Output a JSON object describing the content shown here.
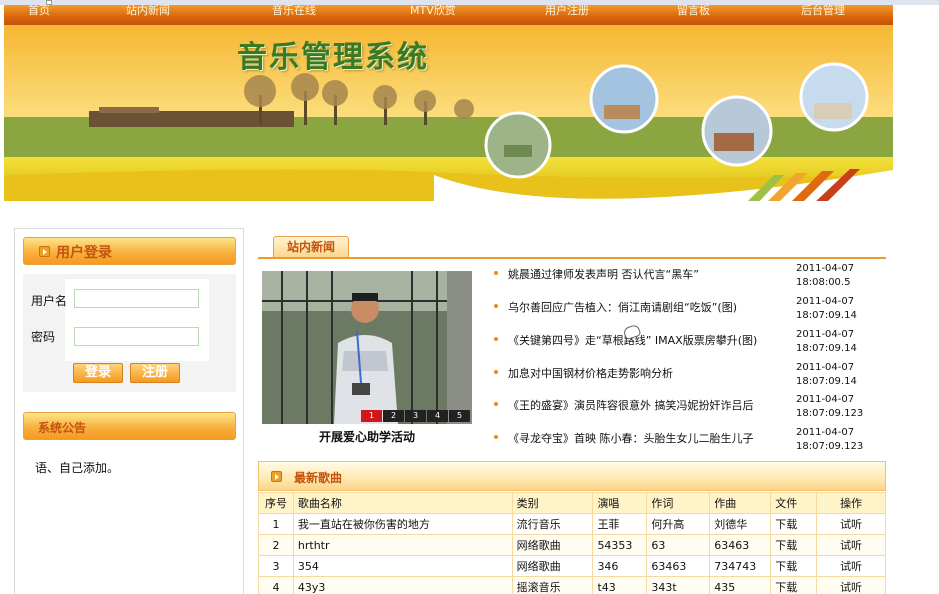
{
  "nav": {
    "items": [
      "首页",
      "站内新闻",
      "音乐在线",
      "MTV欣赏",
      "用户注册",
      "留言板",
      "后台管理"
    ]
  },
  "banner": {
    "title": "音乐管理系统"
  },
  "login": {
    "header": "用户登录",
    "username_label": "用户名",
    "password_label": "密码",
    "username_value": "",
    "password_value": "",
    "login_button": "登录",
    "register_button": "注册"
  },
  "notice": {
    "header": "系统公告",
    "body": "语、自己添加。"
  },
  "news": {
    "tab": "站内新闻",
    "photo_caption": "开展爱心助学活动",
    "pager": [
      "1",
      "2",
      "3",
      "4",
      "5"
    ],
    "items": [
      {
        "title": "姚晨通过律师发表声明 否认代言“黑车”",
        "time": "2011-04-07\n18:08:00.5"
      },
      {
        "title": "乌尔善回应广告植入：俏江南请剧组“吃饭”(图)",
        "time": "2011-04-07\n18:07:09.14"
      },
      {
        "title": "《关键第四号》走“草根路线” IMAX版票房攀升(图)",
        "time": "2011-04-07\n18:07:09.14"
      },
      {
        "title": "加息对中国钢材价格走势影响分析",
        "time": "2011-04-07\n18:07:09.14"
      },
      {
        "title": "《王的盛宴》演员阵容很意外 搞笑冯妮扮奸诈吕后",
        "time": "2011-04-07\n18:07:09.123"
      },
      {
        "title": "《寻龙夺宝》首映 陈小春：头胎生女儿二胎生儿子",
        "time": "2011-04-07\n18:07:09.123"
      }
    ]
  },
  "songs": {
    "header": "最新歌曲",
    "columns": [
      "序号",
      "歌曲名称",
      "类别",
      "演唱",
      "作词",
      "作曲",
      "文件",
      "操作"
    ],
    "rows": [
      {
        "no": "1",
        "name": "我一直站在被你伤害的地方",
        "category": "流行音乐",
        "singer": "王菲",
        "lyricist": "何升高",
        "composer": "刘德华",
        "file": "下载",
        "action": "试听"
      },
      {
        "no": "2",
        "name": "hrthtr",
        "category": "网络歌曲",
        "singer": "54353",
        "lyricist": "63",
        "composer": "63463",
        "file": "下载",
        "action": "试听"
      },
      {
        "no": "3",
        "name": "354",
        "category": "网络歌曲",
        "singer": "346",
        "lyricist": "63463",
        "composer": "734743",
        "file": "下载",
        "action": "试听"
      },
      {
        "no": "4",
        "name": "43y3",
        "category": "摇滚音乐",
        "singer": "t43",
        "lyricist": "343t",
        "composer": "435",
        "file": "下载",
        "action": "试听"
      }
    ]
  },
  "colors": {
    "nav_orange": "#d9650a",
    "header_text": "#c4530e",
    "title_green": "#3b7a22",
    "pager_active": "#d2141b"
  }
}
